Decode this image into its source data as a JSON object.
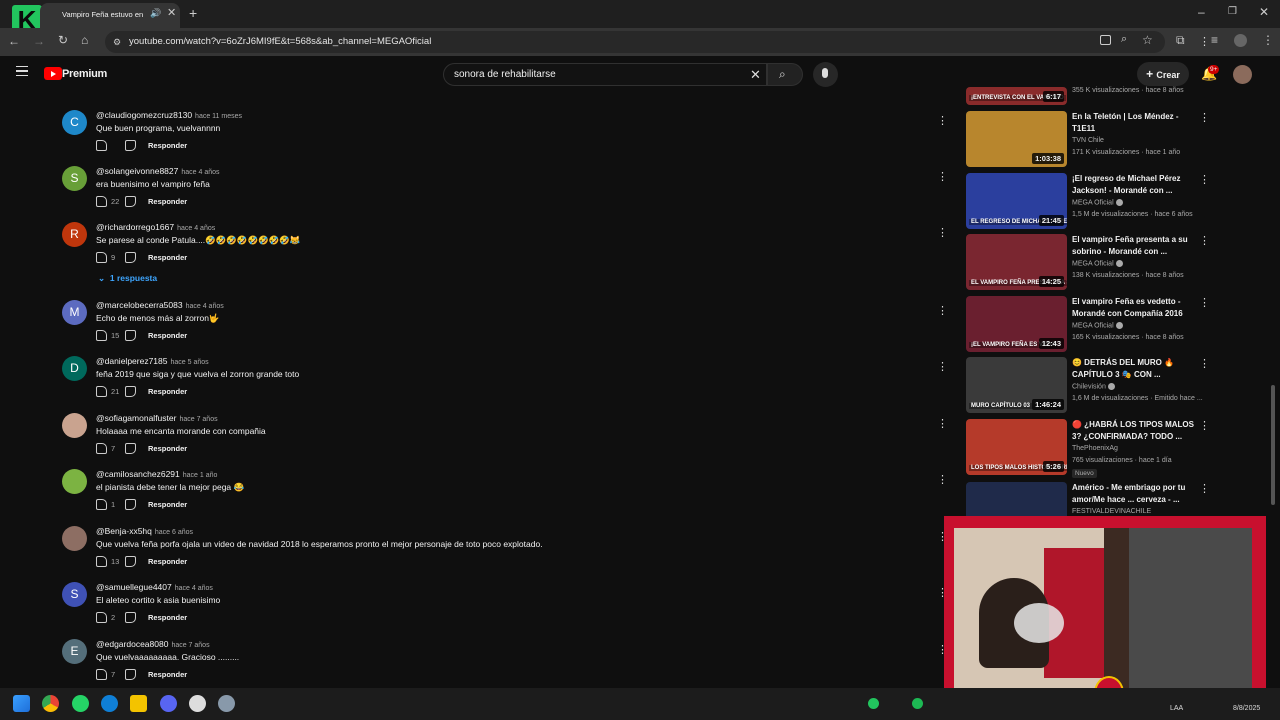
{
  "browser": {
    "tab_title": "Vampiro Feña estuvo en",
    "url": "youtube.com/watch?v=6oZrJ6MI9fE&t=568s&ab_channel=MEGAOficial",
    "overlay_number": "9"
  },
  "youtube": {
    "logo_label": "Premium",
    "search_value": "sonora de rehabilitarse",
    "create_label": "Crear",
    "notifications_badge": "9+"
  },
  "comments": [
    {
      "initial": "C",
      "color": "#1e88c9",
      "author": "@claudiogomezcruz8130",
      "time": "hace 11 meses",
      "text": "Que buen programa, vuelvannnn",
      "likes": "",
      "reply_label": "Responder"
    },
    {
      "initial": "S",
      "color": "#689f38",
      "author": "@solangeivonne8827",
      "time": "hace 4 años",
      "text": "era buenisimo el vampiro feña",
      "likes": "22",
      "reply_label": "Responder"
    },
    {
      "initial": "R",
      "color": "#bf360c",
      "author": "@richardorrego1667",
      "time": "hace 4 años",
      "text": "Se parese al conde Patula....🤣🤣🤣🤣🤣🤣🤣🤣😹",
      "likes": "9",
      "reply_label": "Responder"
    },
    {
      "initial": "M",
      "color": "#5c6bc0",
      "author": "@marcelobecerra5083",
      "time": "hace 4 años",
      "text": "Echo de menos más al zorron🤟",
      "likes": "15",
      "reply_label": "Responder"
    },
    {
      "initial": "D",
      "color": "#00695c",
      "author": "@danielperez7185",
      "time": "hace 5 años",
      "text": "feña 2019 que siga y que vuelva el zorron grande toto",
      "likes": "21",
      "reply_label": "Responder"
    },
    {
      "initial": "",
      "color": "#c9a38f",
      "author": "@sofiagamonalfuster",
      "time": "hace 7 años",
      "text": "Holaaaa me encanta morande con compañia",
      "likes": "7",
      "reply_label": "Responder"
    },
    {
      "initial": "",
      "color": "#7cb342",
      "author": "@camilosanchez6291",
      "time": "hace 1 año",
      "text": "el pianista debe tener la mejor pega 😂",
      "likes": "1",
      "reply_label": "Responder"
    },
    {
      "initial": "",
      "color": "#8d6e63",
      "author": "@Benja-xx5hq",
      "time": "hace 6 años",
      "text": "Que vuelva feña porfa ojala un video de navidad 2018 lo esperamos pronto el mejor personaje de toto poco explotado.",
      "likes": "13",
      "reply_label": "Responder"
    },
    {
      "initial": "S",
      "color": "#3f51b5",
      "author": "@samuellegue4407",
      "time": "hace 4 años",
      "text": "El aleteo cortito k asia buenisimo",
      "likes": "2",
      "reply_label": "Responder"
    },
    {
      "initial": "E",
      "color": "#546e7a",
      "author": "@edgardocea8080",
      "time": "hace 7 años",
      "text": "Que vuelvaaaaaaaaa. Gracioso .........",
      "likes": "7",
      "reply_label": "Responder"
    }
  ],
  "replies_link": "1 respuesta",
  "recommendations": [
    {
      "thumb_color": "#8a2b2b",
      "thumb_caption": "¡ENTREVISTA CON EL VAMPIRO",
      "duration": "6:17",
      "title": "",
      "channel": "",
      "meta": "355 K visualizaciones · hace 8 años",
      "verified": false,
      "badge": ""
    },
    {
      "thumb_color": "#b8862d",
      "thumb_caption": "",
      "duration": "1:03:38",
      "title": "En la Teletón | Los Méndez - T1E11",
      "channel": "TVN Chile",
      "meta": "171 K visualizaciones · hace 1 año",
      "verified": false,
      "badge": ""
    },
    {
      "thumb_color": "#2b3f9e",
      "thumb_caption": "EL REGRESO DE MICHAEL PÉREZ",
      "duration": "21:45",
      "title": "¡El regreso de Michael Pérez Jackson! - Morandé con ...",
      "channel": "MEGA Oficial",
      "meta": "1,5 M de visualizaciones · hace 6 años",
      "verified": true,
      "badge": ""
    },
    {
      "thumb_color": "#7a2630",
      "thumb_caption": "EL VAMPIRO FEÑA PRESENTA A SU",
      "duration": "14:25",
      "title": "El vampiro Feña presenta a su sobrino - Morandé con ...",
      "channel": "MEGA Oficial",
      "meta": "138 K visualizaciones · hace 8 años",
      "verified": true,
      "badge": ""
    },
    {
      "thumb_color": "#6a1f2f",
      "thumb_caption": "¡EL VAMPIRO FEÑA ES VEDE",
      "duration": "12:43",
      "title": "El vampiro Feña es vedetto - Morandé con Compañía 2016",
      "channel": "MEGA Oficial",
      "meta": "165 K visualizaciones · hace 8 años",
      "verified": true,
      "badge": ""
    },
    {
      "thumb_color": "#3a3a3a",
      "thumb_caption": "MURO CAPÍTULO 03",
      "duration": "1:46:24",
      "title": "😊 DETRÁS DEL MURO 🔥 CAPÍTULO 3 🎭 CON ...",
      "channel": "Chilevisión",
      "meta": "1,6 M de visualizaciones · Emitido hace ...",
      "verified": true,
      "badge": ""
    },
    {
      "thumb_color": "#b53a2a",
      "thumb_caption": "LOS TIPOS MALOS HISTORIA FRITRAGA",
      "duration": "5:26",
      "title": "🔴 ¿HABRÁ LOS TIPOS MALOS 3? ¿CONFIRMADA? TODO ...",
      "channel": "ThePhoenixAg",
      "meta": "765 visualizaciones · hace 1 día",
      "verified": false,
      "badge": "Nuevo"
    },
    {
      "thumb_color": "#1f2a4a",
      "thumb_caption": "",
      "duration": "",
      "title": "Américo - Me embriago por tu amor/Me hace ... cerveza - ...",
      "channel": "FESTIVALDEVINACHILE",
      "meta": "",
      "verified": false,
      "badge": ""
    }
  ],
  "taskbar": {
    "lang": "LAA",
    "date": "8/8/2025"
  }
}
